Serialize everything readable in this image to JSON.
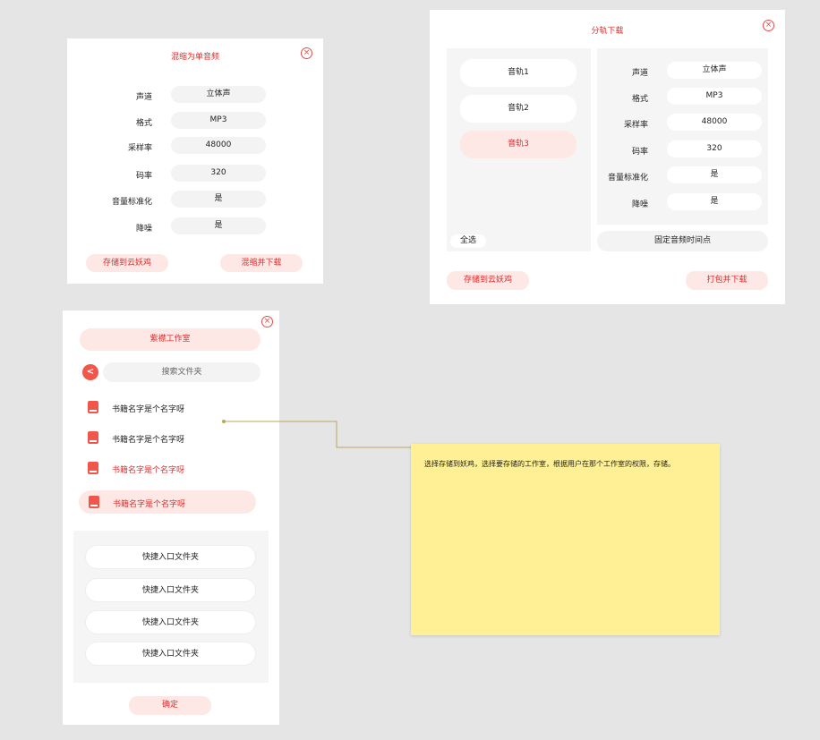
{
  "panel1": {
    "title": "混缩为单音频",
    "close_icon": "×",
    "rows": [
      {
        "label": "声道",
        "value": "立体声"
      },
      {
        "label": "格式",
        "value": "MP3"
      },
      {
        "label": "采样率",
        "value": "48000"
      },
      {
        "label": "码率",
        "value": "320"
      },
      {
        "label": "音量标准化",
        "value": "是"
      },
      {
        "label": "降噪",
        "value": "是"
      }
    ],
    "save_label": "存储到云妖鸡",
    "download_label": "混缩并下载"
  },
  "panel2": {
    "title": "分轨下载",
    "close_icon": "×",
    "tracks": [
      "音轨1",
      "音轨2",
      "音轨3"
    ],
    "select_all": "全选",
    "rows": [
      {
        "label": "声道",
        "value": "立体声"
      },
      {
        "label": "格式",
        "value": "MP3"
      },
      {
        "label": "采样率",
        "value": "48000"
      },
      {
        "label": "码率",
        "value": "320"
      },
      {
        "label": "音量标准化",
        "value": "是"
      },
      {
        "label": "降噪",
        "value": "是"
      }
    ],
    "fixed_time_label": "固定音频时间点",
    "save_label": "存储到云妖鸡",
    "download_label": "打包并下载"
  },
  "panel3": {
    "close_icon": "×",
    "studio_label": "紫襟工作室",
    "back_icon": "<",
    "search_placeholder": "搜索文件夹",
    "books": [
      {
        "label": "书籍名字是个名字呀"
      },
      {
        "label": "书籍名字是个名字呀"
      },
      {
        "label": "书籍名字是个名字呀"
      },
      {
        "label": "书籍名字是个名字呀"
      }
    ],
    "shortcuts": [
      "快捷入口文件夹",
      "快捷入口文件夹",
      "快捷入口文件夹",
      "快捷入口文件夹"
    ],
    "confirm_label": "确定"
  },
  "note": {
    "text": "选择存储到妖鸡，选择要存储的工作室，根据用户在那个工作室的权限，存储。"
  },
  "colors": {
    "accent": "#e12b2b",
    "accent_bg": "#fde8e6",
    "note_bg": "#fff096"
  }
}
